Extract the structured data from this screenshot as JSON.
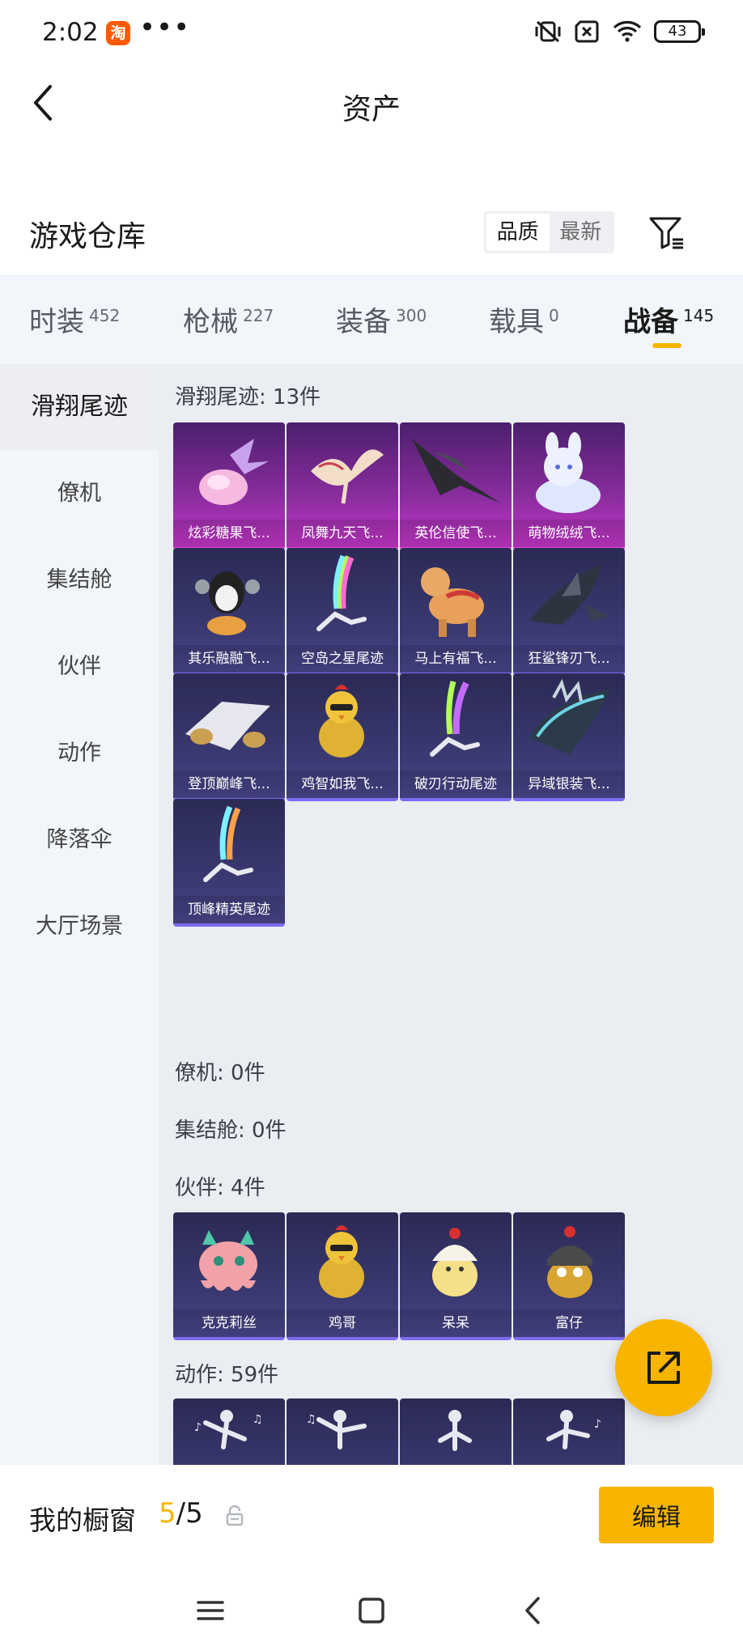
{
  "status_bar": {
    "time": "2:02",
    "app_icon_label": "淘",
    "dots": "•••",
    "battery": "43"
  },
  "header": {
    "title": "资产"
  },
  "warehouse": {
    "title": "游戏仓库",
    "sort_options": [
      "品质",
      "最新"
    ],
    "active_sort": "品质"
  },
  "tabs": [
    {
      "label": "时装",
      "count": "452"
    },
    {
      "label": "枪械",
      "count": "227"
    },
    {
      "label": "装备",
      "count": "300"
    },
    {
      "label": "载具",
      "count": "0"
    },
    {
      "label": "战备",
      "count": "145",
      "active": true
    }
  ],
  "sidebar": {
    "items": [
      "滑翔尾迹",
      "僚机",
      "集结舱",
      "伙伴",
      "动作",
      "降落伞",
      "大厅场景"
    ],
    "active": "滑翔尾迹"
  },
  "sections": {
    "trails": {
      "title": "滑翔尾迹: 13件",
      "items": [
        {
          "label": "炫彩糖果飞...",
          "rarity": "pink",
          "icon": "candy-wing-icon"
        },
        {
          "label": "凤舞九天飞...",
          "rarity": "pink",
          "icon": "phoenix-icon"
        },
        {
          "label": "英伦信使飞...",
          "rarity": "pink",
          "icon": "raven-icon"
        },
        {
          "label": "萌物绒绒飞...",
          "rarity": "pink",
          "icon": "plush-bunny-icon"
        },
        {
          "label": "其乐融融飞...",
          "rarity": "blue",
          "icon": "penguin-icon"
        },
        {
          "label": "空岛之星尾迹",
          "rarity": "blue",
          "icon": "rainbow-trail-icon"
        },
        {
          "label": "马上有福飞...",
          "rarity": "blue",
          "icon": "toy-horse-icon"
        },
        {
          "label": "狂鲨锋刃飞...",
          "rarity": "blue",
          "icon": "shark-icon"
        },
        {
          "label": "登顶巅峰飞...",
          "rarity": "blue",
          "icon": "jet-wing-icon"
        },
        {
          "label": "鸡智如我飞...",
          "rarity": "blue",
          "icon": "chicken-icon"
        },
        {
          "label": "破刃行动尾迹",
          "rarity": "blue",
          "icon": "rainbow-trail-icon"
        },
        {
          "label": "异域银装飞...",
          "rarity": "blue",
          "icon": "silver-wing-icon"
        },
        {
          "label": "顶峰精英尾迹",
          "rarity": "blue",
          "icon": "rainbow-trail-icon"
        }
      ]
    },
    "wingman": {
      "title": "僚机: 0件"
    },
    "capsule": {
      "title": "集结舱: 0件"
    },
    "partners": {
      "title": "伙伴: 4件",
      "items": [
        {
          "label": "克克莉丝",
          "rarity": "blue",
          "icon": "octopus-icon"
        },
        {
          "label": "鸡哥",
          "rarity": "blue",
          "icon": "chicken-icon"
        },
        {
          "label": "呆呆",
          "rarity": "blue",
          "icon": "chick-icon"
        },
        {
          "label": "富仔",
          "rarity": "blue",
          "icon": "helmet-chick-icon"
        }
      ]
    },
    "emotes": {
      "title": "动作: 59件",
      "items": [
        {
          "label": "",
          "rarity": "blue",
          "icon": "dance-icon"
        },
        {
          "label": "",
          "rarity": "blue",
          "icon": "dance-icon"
        },
        {
          "label": "",
          "rarity": "blue",
          "icon": "dance-icon"
        },
        {
          "label": "",
          "rarity": "blue",
          "icon": "dance-icon"
        }
      ]
    }
  },
  "showcase": {
    "label": "我的橱窗",
    "current": "5",
    "total": "/5",
    "edit_label": "编辑"
  },
  "colors": {
    "accent": "#f7b500",
    "pink_card": "#c437c9",
    "blue_card": "#3b3a73"
  }
}
